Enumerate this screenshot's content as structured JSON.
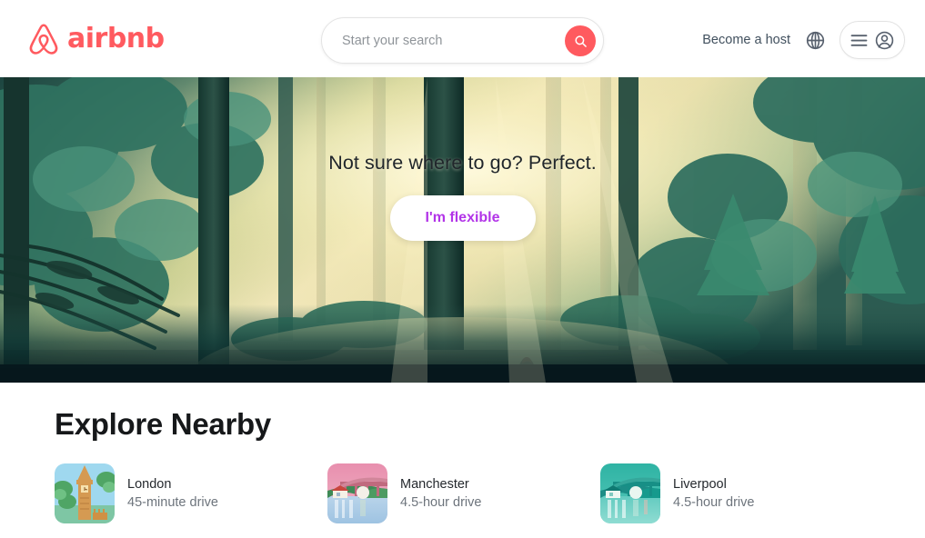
{
  "header": {
    "logo": {
      "icon": "airbnb-belo-icon",
      "wordmark": "airbnb",
      "brand_color": "#FF5A5F"
    },
    "search": {
      "placeholder": "Start your search",
      "value": "",
      "button_icon": "search-icon",
      "button_color": "#FF5A5F"
    },
    "become_host_label": "Become a host",
    "globe_icon": "globe-icon",
    "menu_icon": "hamburger-menu-icon",
    "avatar_icon": "user-avatar-icon"
  },
  "hero": {
    "image_alt": "sunlit-redwood-forest-with-family-walking-dog",
    "title": "Not sure where to go? Perfect.",
    "cta_label": "I'm flexible",
    "cta_text_color": "#b234e8",
    "cta_bg_color": "#ffffff"
  },
  "explore": {
    "title": "Explore Nearby",
    "cities": [
      {
        "name": "London",
        "drive": "45-minute drive",
        "thumb": "big-ben-illustration"
      },
      {
        "name": "Manchester",
        "drive": "4.5-hour drive",
        "thumb": "pink-bridge-river-illustration"
      },
      {
        "name": "Liverpool",
        "drive": "4.5-hour drive",
        "thumb": "teal-bridge-river-illustration"
      }
    ]
  }
}
